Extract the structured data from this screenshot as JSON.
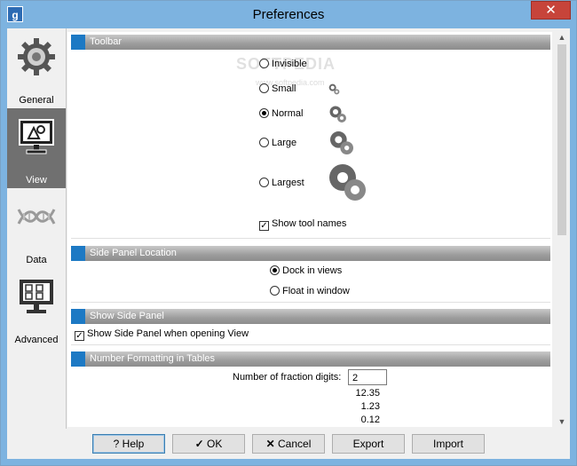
{
  "window": {
    "title": "Preferences",
    "app_icon": "g",
    "close_label": "✕"
  },
  "sidebar": {
    "items": [
      {
        "label": "General",
        "icon": "gear-icon"
      },
      {
        "label": "View",
        "icon": "monitor-icon"
      },
      {
        "label": "Data",
        "icon": "dna-icon"
      },
      {
        "label": "Advanced",
        "icon": "advanced-monitor-icon"
      }
    ],
    "selected": "View"
  },
  "sections": {
    "toolbar": {
      "title": "Toolbar",
      "options": [
        "Invisible",
        "Small",
        "Normal",
        "Large",
        "Largest"
      ],
      "selected": "Normal",
      "show_tool_names_label": "Show tool names",
      "show_tool_names_checked": true
    },
    "side_panel_location": {
      "title": "Side Panel Location",
      "options": [
        "Dock in views",
        "Float in window"
      ],
      "selected": "Dock in views"
    },
    "show_side_panel": {
      "title": "Show Side Panel",
      "checkbox_label": "Show Side Panel when opening View",
      "checked": true
    },
    "number_formatting": {
      "title": "Number Formatting in Tables",
      "fraction_digits_label": "Number of fraction digits:",
      "fraction_digits_value": "2",
      "examples": [
        "12.35",
        "1.23",
        "0.12"
      ]
    }
  },
  "watermark": {
    "text": "SOFTPEDIA",
    "sub": "www.softpedia.com"
  },
  "buttons": {
    "help": "Help",
    "ok": "OK",
    "cancel": "Cancel",
    "export": "Export",
    "import": "Import"
  },
  "colors": {
    "accent": "#1d79c4",
    "titlebar": "#7db3e0",
    "selected_side": "#707070"
  }
}
